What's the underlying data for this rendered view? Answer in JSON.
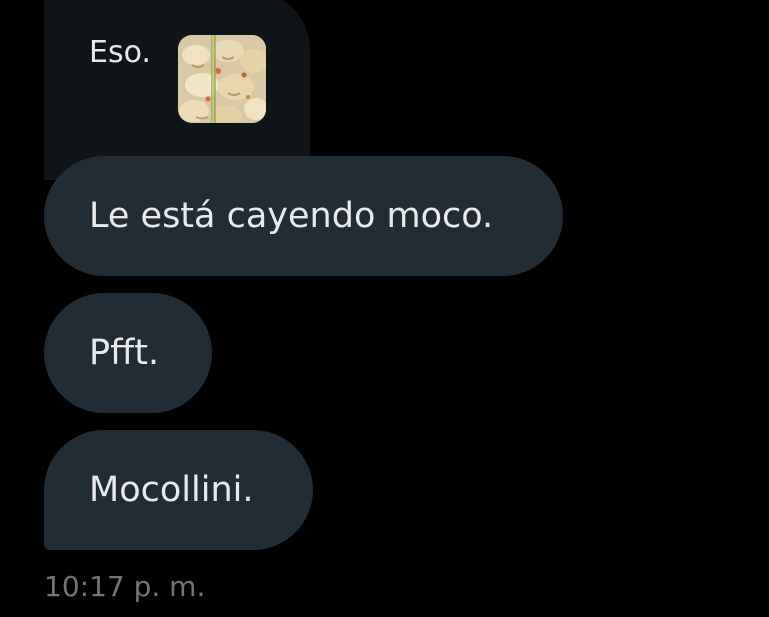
{
  "messages": {
    "quoted": {
      "text": "Eso."
    },
    "items": [
      {
        "text": "Le está cayendo moco."
      },
      {
        "text": "Pfft."
      },
      {
        "text": "Mocollini."
      }
    ],
    "timestamp": "10:17 p. m."
  },
  "colors": {
    "background": "#000000",
    "bubble": "#222c34",
    "quote_card": "#0f1419",
    "text": "#e7e9ea",
    "timestamp": "#71767b"
  }
}
